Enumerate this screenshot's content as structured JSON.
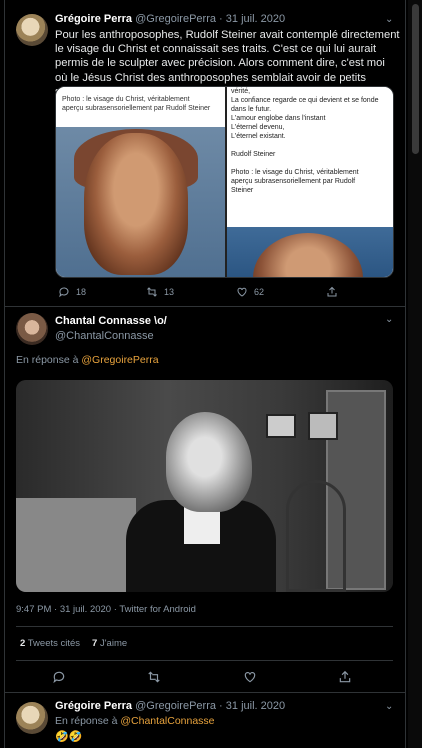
{
  "tweet1": {
    "name": "Grégoire Perra",
    "handle": "@GregoirePerra",
    "sep": "·",
    "date": "31 juil. 2020",
    "text": "Pour les anthroposophes, Rudolf Steiner avait contemplé directement le visage du Christ et connaissait ses traits. C'est ce qui lui aurait permis de le sculpter avec précision. Alors comment dire, c'est moi où le Jésus Christ des anthroposophes semblait avoir de petits soucis ?",
    "media_left_caption": "Photo : le visage du Christ, véritablement aperçu subrasensoriellement par Rudolf Steiner",
    "media_right_lines": [
      "vérité,",
      "La confiance regarde ce qui devient et se fonde",
      "dans le futur.",
      "L'amour englobe dans l'instant",
      "L'éternel devenu,",
      "L'éternel existant.",
      "",
      "Rudolf Steiner",
      "",
      "Photo : le visage du Christ, véritablement",
      "aperçu subrasensoriellement par Rudolf",
      "Steiner"
    ],
    "replies": "18",
    "retweets": "13",
    "likes": "62"
  },
  "tweet2": {
    "name": "Chantal Connasse \\o/",
    "handle": "@ChantalConnasse",
    "reply_prefix": "En réponse à",
    "reply_to": "@GregoirePerra",
    "time": "9:47 PM",
    "date": "31 juil. 2020",
    "source": "Twitter for Android",
    "quotes_count": "2",
    "quotes_label": "Tweets cités",
    "likes_count": "7",
    "likes_label": "J'aime"
  },
  "tweet3": {
    "name": "Grégoire Perra",
    "handle": "@GregoirePerra",
    "date": "31 juil. 2020",
    "reply_prefix": "En réponse à",
    "reply_to": "@ChantalConnasse",
    "text": "🤣🤣"
  },
  "colors": {
    "accent": "#e8a33d",
    "muted": "#8b98a5",
    "bg": "#000000"
  }
}
